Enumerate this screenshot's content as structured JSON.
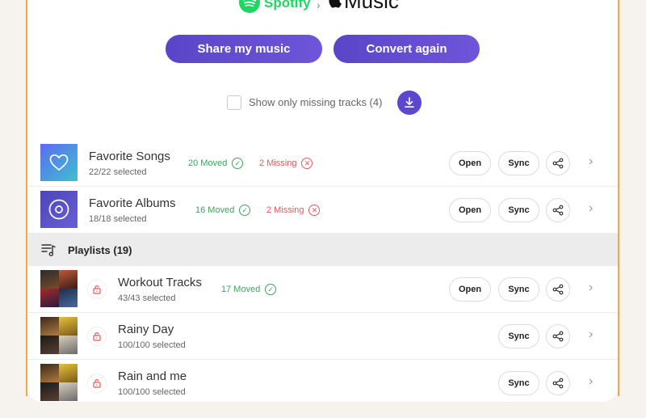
{
  "header": {
    "source_service": "Spotify",
    "arrow": "›",
    "target_service": "Music"
  },
  "actions": {
    "share_label": "Share my music",
    "convert_label": "Convert again"
  },
  "filter": {
    "label": "Show only missing tracks (4)",
    "checked": false
  },
  "collections": [
    {
      "title": "Favorite Songs",
      "selected": "22/22 selected",
      "moved": "20 Moved",
      "missing": "2 Missing",
      "open": "Open",
      "sync": "Sync"
    },
    {
      "title": "Favorite Albums",
      "selected": "18/18 selected",
      "moved": "16 Moved",
      "missing": "2 Missing",
      "open": "Open",
      "sync": "Sync"
    }
  ],
  "playlists_header": {
    "label": "Playlists (19)"
  },
  "playlists": [
    {
      "title": "Workout Tracks",
      "selected": "43/43 selected",
      "moved": "17 Moved",
      "open": "Open",
      "sync": "Sync"
    },
    {
      "title": "Rainy Day",
      "selected": "100/100 selected",
      "sync": "Sync"
    },
    {
      "title": "Rain and me",
      "selected": "100/100 selected",
      "sync": "Sync"
    }
  ],
  "colors": {
    "accent": "#5c47cf",
    "moved": "#3aa55d",
    "missing": "#e15a5a",
    "spotify": "#1ed760",
    "frame": "#f0a944"
  },
  "icons": {
    "favorite_songs": "heart-icon",
    "favorite_albums": "disc-icon",
    "download": "download-icon",
    "share": "share-icon",
    "lock": "lock-icon",
    "playlist": "playlist-icon",
    "chevron": "chevron-right-icon"
  }
}
